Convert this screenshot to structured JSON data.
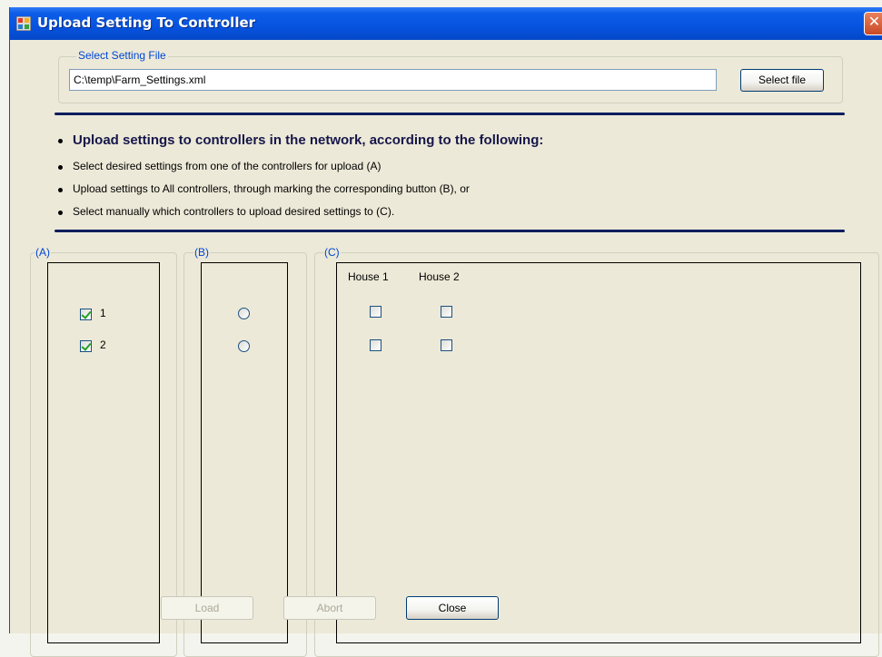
{
  "window": {
    "title": "Upload Setting To Controller",
    "close_glyph": "✕"
  },
  "file_group": {
    "legend": "Select Setting File",
    "path_value": "C:\\temp\\Farm_Settings.xml",
    "select_button": "Select file"
  },
  "instructions": {
    "heading": "Upload settings to controllers in the network, according to the following:",
    "items": [
      "Select desired settings from one of the controllers for upload (A)",
      "Upload settings to All controllers, through marking the corresponding button (B), or",
      "Select manually which controllers to upload desired settings to (C)."
    ]
  },
  "panel_a": {
    "legend": "(A)",
    "controllers": [
      {
        "label": "1",
        "checked": true
      },
      {
        "label": "2",
        "checked": true
      }
    ]
  },
  "panel_b": {
    "legend": "(B)",
    "radios": [
      {
        "selected": false
      },
      {
        "selected": false
      }
    ]
  },
  "panel_c": {
    "legend": "(C)",
    "columns": [
      "House 1",
      "House 2"
    ],
    "rows": [
      [
        false,
        false
      ],
      [
        false,
        false
      ]
    ]
  },
  "footer": {
    "load_button": "Load",
    "abort_button": "Abort",
    "close_button": "Close"
  },
  "colors": {
    "titlebar": "#0653df",
    "accent_legend": "#0046d5",
    "rule": "#0a1e5e"
  }
}
